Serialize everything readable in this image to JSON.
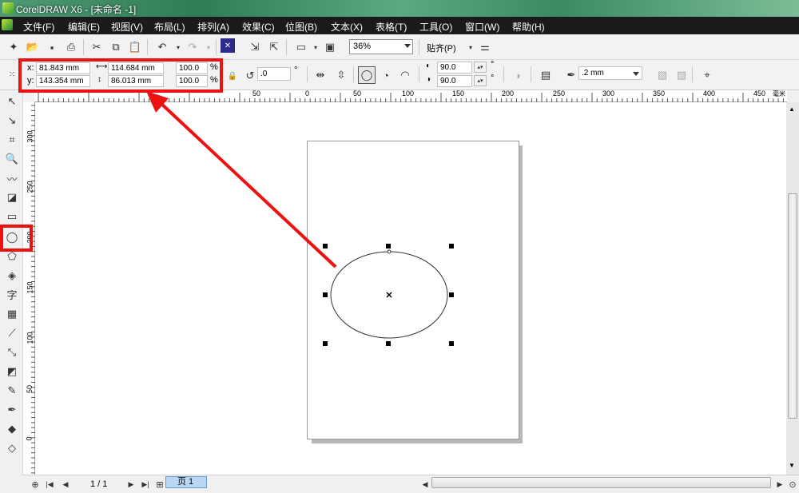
{
  "title_bar": {
    "title": "CorelDRAW X6 - [未命名 -1]"
  },
  "menu": {
    "items": [
      "文件(F)",
      "编辑(E)",
      "视图(V)",
      "布局(L)",
      "排列(A)",
      "效果(C)",
      "位图(B)",
      "文本(X)",
      "表格(T)",
      "工具(O)",
      "窗口(W)",
      "帮助(H)"
    ]
  },
  "toolbar": {
    "zoom_value": "36%",
    "snap_label": "贴齐(P)"
  },
  "property_bar": {
    "x_label": "x:",
    "x_value": "81.843 mm",
    "y_label": "y:",
    "y_value": "143.354 mm",
    "width_value": "114.684 mm",
    "height_value": "86.013 mm",
    "scale_x": "100.0",
    "scale_y": "100.0",
    "percent": "%",
    "rotation_value": ".0",
    "degree": "°",
    "start_angle": "90.0",
    "end_angle": "90.0",
    "outline_width": ".2 mm"
  },
  "ruler": {
    "h_ticks": [
      "50",
      "0",
      "50",
      "100",
      "150",
      "200",
      "250",
      "300",
      "350",
      "400",
      "450"
    ],
    "unit": "毫米",
    "v_ticks": [
      "300",
      "250",
      "200",
      "150",
      "100",
      "50",
      "0"
    ]
  },
  "status": {
    "page_counter": "1 / 1",
    "page_tab": "页 1"
  },
  "colors": {
    "highlight": "#ee1111",
    "arrow": "#ee1111"
  }
}
